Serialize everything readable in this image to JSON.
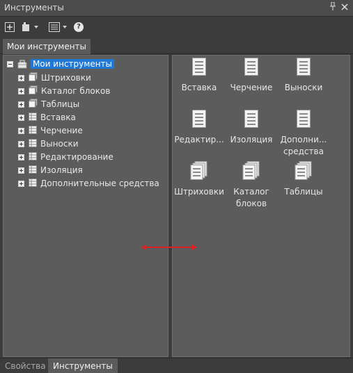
{
  "window": {
    "title": "Инструменты"
  },
  "tabs": {
    "top": "Мои инструменты",
    "bottom": [
      "Свойства",
      "Инструменты"
    ]
  },
  "tree": {
    "root": "Мои инструменты",
    "items": [
      "Штриховки",
      "Каталог блоков",
      "Таблицы",
      "Вставка",
      "Черчение",
      "Выноски",
      "Редактирование",
      "Изоляция",
      "Дополнительные средства"
    ]
  },
  "tools": [
    {
      "line1": "Вставка",
      "line2": "",
      "icon": "palette-icon"
    },
    {
      "line1": "Черчение",
      "line2": "",
      "icon": "palette-icon"
    },
    {
      "line1": "Выноски",
      "line2": "",
      "icon": "palette-icon"
    },
    {
      "line1": "Редактир...",
      "line2": "",
      "icon": "palette-icon"
    },
    {
      "line1": "Изоляция",
      "line2": "",
      "icon": "palette-icon"
    },
    {
      "line1": "Дополни...",
      "line2": "средства",
      "icon": "palette-icon"
    },
    {
      "line1": "Штриховки",
      "line2": "",
      "icon": "palette-group-icon"
    },
    {
      "line1": "Каталог",
      "line2": "блоков",
      "icon": "palette-group-icon"
    },
    {
      "line1": "Таблицы",
      "line2": "",
      "icon": "palette-group-icon"
    }
  ],
  "colors": {
    "selection": "#1f78d6",
    "panel": "#5c5c5c",
    "background": "#3c3c3c",
    "cursor": "#e02020"
  }
}
